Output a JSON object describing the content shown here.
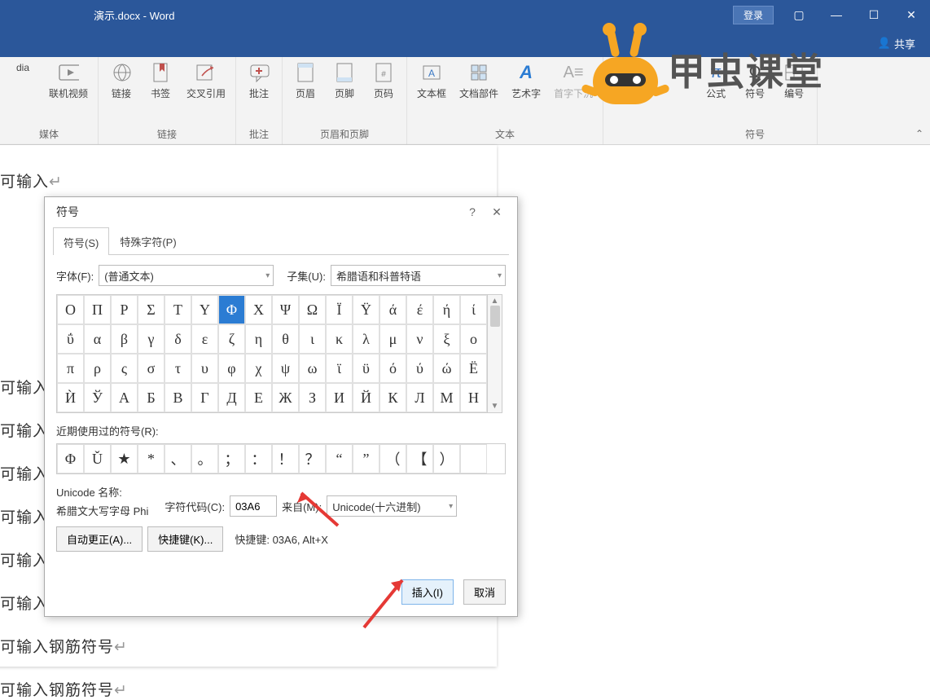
{
  "window": {
    "title": "演示.docx  -  Word",
    "login": "登录",
    "share": "共享"
  },
  "ribbon": {
    "items": {
      "media0": "dia",
      "onlinevideo": "联机视频",
      "link": "链接",
      "bookmark": "书签",
      "crossref": "交叉引用",
      "comment": "批注",
      "header": "页眉",
      "footer": "页脚",
      "pagenum": "页码",
      "textbox": "文本框",
      "quickparts": "文档部件",
      "wordart": "艺术字",
      "dropcap": "首字下沉",
      "equation": "公式",
      "symbol": "符号",
      "number": "编号"
    },
    "groups": {
      "media": "媒体",
      "links": "链接",
      "comments": "批注",
      "headerfooter": "页眉和页脚",
      "text": "文本",
      "symbols": "符号"
    }
  },
  "doc": {
    "lines": [
      "可输入",
      "可输入",
      "可输入",
      "可输入",
      "可输入",
      "可输入",
      "可输入",
      "可输入钢筋符号",
      "可输入钢筋符号"
    ]
  },
  "dialog": {
    "title": "符号",
    "tabs": {
      "symbols": "符号(S)",
      "special": "特殊字符(P)"
    },
    "font_label": "字体(F):",
    "font_value": "(普通文本)",
    "subset_label": "子集(U):",
    "subset_value": "希腊语和科普特语",
    "grid": [
      [
        "Ο",
        "Π",
        "Ρ",
        "Σ",
        "Τ",
        "Υ",
        "Φ",
        "Χ",
        "Ψ",
        "Ω",
        "Ϊ",
        "Ϋ",
        "ά",
        "έ",
        "ή",
        "ί"
      ],
      [
        "ΰ",
        "α",
        "β",
        "γ",
        "δ",
        "ε",
        "ζ",
        "η",
        "θ",
        "ι",
        "κ",
        "λ",
        "μ",
        "ν",
        "ξ",
        "ο"
      ],
      [
        "π",
        "ρ",
        "ς",
        "σ",
        "τ",
        "υ",
        "φ",
        "χ",
        "ψ",
        "ω",
        "ϊ",
        "ϋ",
        "ό",
        "ύ",
        "ώ",
        "Ё"
      ],
      [
        "Ѝ",
        "Ў",
        "А",
        "Б",
        "В",
        "Г",
        "Д",
        "Е",
        "Ж",
        "З",
        "И",
        "Й",
        "К",
        "Л",
        "М",
        "Н"
      ]
    ],
    "selected_index": [
      0,
      6
    ],
    "recent_label": "近期使用过的符号(R):",
    "recent": [
      "Φ",
      "Ǔ",
      "★",
      "*",
      "、",
      "。",
      "；",
      "：",
      "！",
      "？",
      "“",
      "”",
      "（",
      "【",
      "）",
      ""
    ],
    "unicode_name_label": "Unicode 名称:",
    "unicode_name": "希腊文大写字母 Phi",
    "charcode_label": "字符代码(C):",
    "charcode_value": "03A6",
    "from_label": "来自(M):",
    "from_value": "Unicode(十六进制)",
    "autocorrect": "自动更正(A)...",
    "shortcutkey": "快捷键(K)...",
    "shortcut_label": "快捷键: 03A6, Alt+X",
    "insert": "插入(I)",
    "cancel": "取消"
  },
  "logo": {
    "text": "甲虫课堂"
  }
}
